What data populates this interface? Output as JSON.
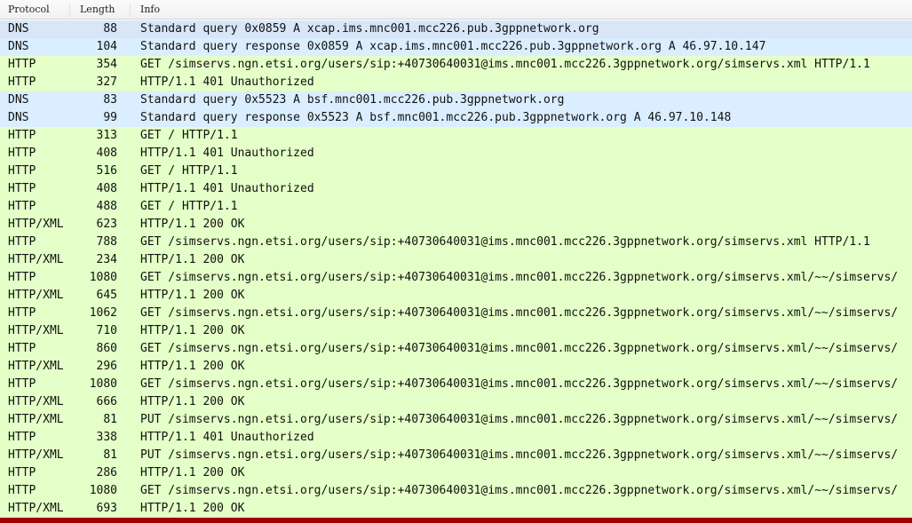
{
  "columns": {
    "protocol": "Protocol",
    "length": "Length",
    "info": "Info"
  },
  "colors": {
    "dns_row": "#daeeff",
    "http_row": "#e4ffc7",
    "selected_row": "#d8e6f8"
  },
  "packets": [
    {
      "protocol": "DNS",
      "length": "88",
      "info": "Standard query 0x0859 A xcap.ims.mnc001.mcc226.pub.3gppnetwork.org",
      "type": "dns"
    },
    {
      "protocol": "DNS",
      "length": "104",
      "info": "Standard query response 0x0859 A xcap.ims.mnc001.mcc226.pub.3gppnetwork.org A 46.97.10.147",
      "type": "dns"
    },
    {
      "protocol": "HTTP",
      "length": "354",
      "info": "GET /simservs.ngn.etsi.org/users/sip:+40730640031@ims.mnc001.mcc226.3gppnetwork.org/simservs.xml HTTP/1.1",
      "type": "http"
    },
    {
      "protocol": "HTTP",
      "length": "327",
      "info": "HTTP/1.1 401 Unauthorized",
      "type": "http"
    },
    {
      "protocol": "DNS",
      "length": "83",
      "info": "Standard query 0x5523 A bsf.mnc001.mcc226.pub.3gppnetwork.org",
      "type": "dns"
    },
    {
      "protocol": "DNS",
      "length": "99",
      "info": "Standard query response 0x5523 A bsf.mnc001.mcc226.pub.3gppnetwork.org A 46.97.10.148",
      "type": "dns"
    },
    {
      "protocol": "HTTP",
      "length": "313",
      "info": "GET / HTTP/1.1",
      "type": "http"
    },
    {
      "protocol": "HTTP",
      "length": "408",
      "info": "HTTP/1.1 401 Unauthorized",
      "type": "http"
    },
    {
      "protocol": "HTTP",
      "length": "516",
      "info": "GET / HTTP/1.1",
      "type": "http"
    },
    {
      "protocol": "HTTP",
      "length": "408",
      "info": "HTTP/1.1 401 Unauthorized",
      "type": "http"
    },
    {
      "protocol": "HTTP",
      "length": "488",
      "info": "GET / HTTP/1.1",
      "type": "http"
    },
    {
      "protocol": "HTTP/XML",
      "length": "623",
      "info": "HTTP/1.1 200 OK",
      "type": "http"
    },
    {
      "protocol": "HTTP",
      "length": "788",
      "info": "GET /simservs.ngn.etsi.org/users/sip:+40730640031@ims.mnc001.mcc226.3gppnetwork.org/simservs.xml HTTP/1.1",
      "type": "http"
    },
    {
      "protocol": "HTTP/XML",
      "length": "234",
      "info": "HTTP/1.1 200 OK",
      "type": "http"
    },
    {
      "protocol": "HTTP",
      "length": "1080",
      "info": "GET /simservs.ngn.etsi.org/users/sip:+40730640031@ims.mnc001.mcc226.3gppnetwork.org/simservs.xml/~~/simservs/",
      "type": "http"
    },
    {
      "protocol": "HTTP/XML",
      "length": "645",
      "info": "HTTP/1.1 200 OK",
      "type": "http"
    },
    {
      "protocol": "HTTP",
      "length": "1062",
      "info": "GET /simservs.ngn.etsi.org/users/sip:+40730640031@ims.mnc001.mcc226.3gppnetwork.org/simservs.xml/~~/simservs/",
      "type": "http"
    },
    {
      "protocol": "HTTP/XML",
      "length": "710",
      "info": "HTTP/1.1 200 OK",
      "type": "http"
    },
    {
      "protocol": "HTTP",
      "length": "860",
      "info": "GET /simservs.ngn.etsi.org/users/sip:+40730640031@ims.mnc001.mcc226.3gppnetwork.org/simservs.xml/~~/simservs/",
      "type": "http"
    },
    {
      "protocol": "HTTP/XML",
      "length": "296",
      "info": "HTTP/1.1 200 OK",
      "type": "http"
    },
    {
      "protocol": "HTTP",
      "length": "1080",
      "info": "GET /simservs.ngn.etsi.org/users/sip:+40730640031@ims.mnc001.mcc226.3gppnetwork.org/simservs.xml/~~/simservs/",
      "type": "http"
    },
    {
      "protocol": "HTTP/XML",
      "length": "666",
      "info": "HTTP/1.1 200 OK",
      "type": "http"
    },
    {
      "protocol": "HTTP/XML",
      "length": "81",
      "info": "PUT /simservs.ngn.etsi.org/users/sip:+40730640031@ims.mnc001.mcc226.3gppnetwork.org/simservs.xml/~~/simservs/",
      "type": "http"
    },
    {
      "protocol": "HTTP",
      "length": "338",
      "info": "HTTP/1.1 401 Unauthorized",
      "type": "http"
    },
    {
      "protocol": "HTTP/XML",
      "length": "81",
      "info": "PUT /simservs.ngn.etsi.org/users/sip:+40730640031@ims.mnc001.mcc226.3gppnetwork.org/simservs.xml/~~/simservs/",
      "type": "http"
    },
    {
      "protocol": "HTTP",
      "length": "286",
      "info": "HTTP/1.1 200 OK",
      "type": "http"
    },
    {
      "protocol": "HTTP",
      "length": "1080",
      "info": "GET /simservs.ngn.etsi.org/users/sip:+40730640031@ims.mnc001.mcc226.3gppnetwork.org/simservs.xml/~~/simservs/",
      "type": "http"
    },
    {
      "protocol": "HTTP/XML",
      "length": "693",
      "info": "HTTP/1.1 200 OK",
      "type": "http"
    }
  ]
}
